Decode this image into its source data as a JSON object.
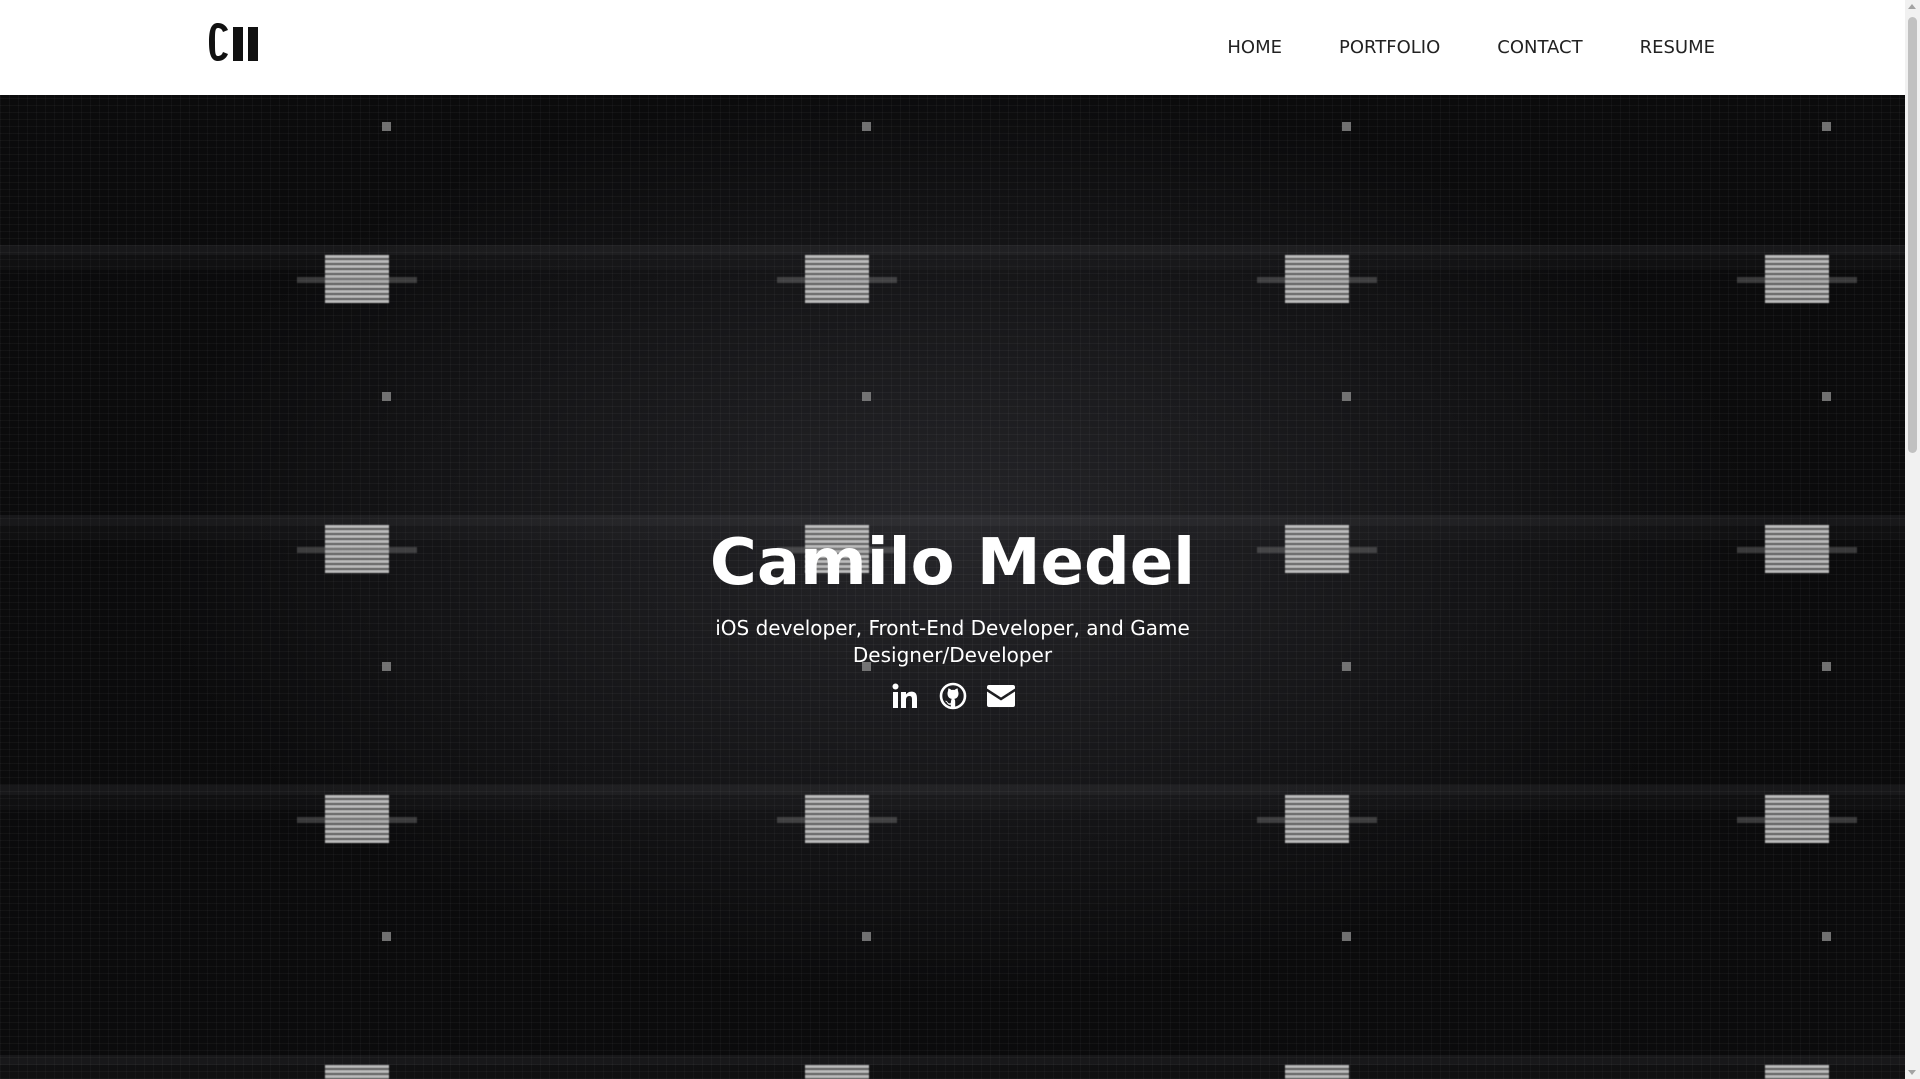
{
  "header": {
    "logo_text": "CM",
    "nav": [
      {
        "label": "HOME"
      },
      {
        "label": "PORTFOLIO"
      },
      {
        "label": "CONTACT"
      },
      {
        "label": "RESUME"
      }
    ]
  },
  "hero": {
    "name": "Camilo Medel",
    "tagline": "iOS developer, Front-End Developer, and Game Designer/Developer",
    "social": [
      {
        "icon": "linkedin-icon"
      },
      {
        "icon": "github-icon"
      },
      {
        "icon": "envelope-icon"
      }
    ]
  },
  "colors": {
    "header_bg": "#ffffff",
    "nav_text": "#222222",
    "hero_bg": "#0b0b0c",
    "hero_text": "#ffffff"
  }
}
